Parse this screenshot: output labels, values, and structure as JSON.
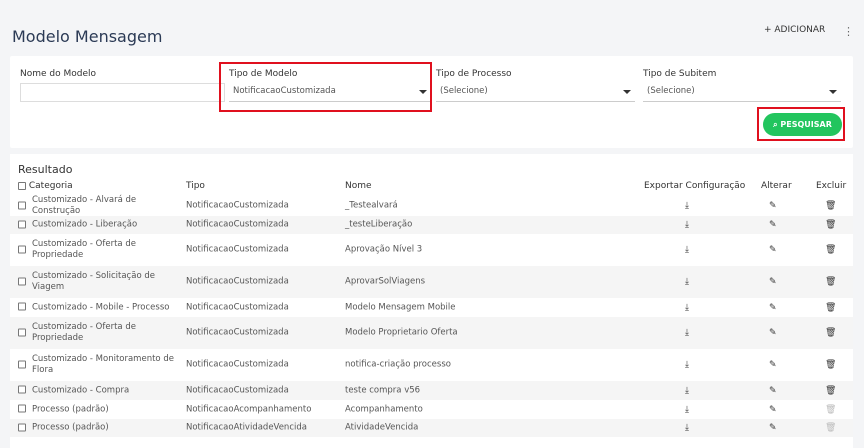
{
  "header": {
    "title": "Modelo Mensagem",
    "add_label": "+ ADICIONAR",
    "menu_label": "⋮"
  },
  "filters": {
    "nome_label": "Nome do Modelo",
    "nome_value": "",
    "tipo_label": "Tipo de Modelo",
    "tipo_value": "NotificacaoCustomizada",
    "processo_label": "Tipo de Processo",
    "processo_value": "(Selecione)",
    "subitem_label": "Tipo de Subitem",
    "subitem_value": "(Selecione)",
    "search_label": "PESQUISAR"
  },
  "results": {
    "title": "Resultado",
    "columns": {
      "categoria": "Categoria",
      "tipo": "Tipo",
      "nome": "Nome",
      "exportar": "Exportar Configuração",
      "alterar": "Alterar",
      "excluir": "Excluir"
    },
    "rows": [
      {
        "categoria": "Customizado - Alvará de Construção",
        "tipo": "NotificacaoCustomizada",
        "nome": "_Testealvará",
        "excluir_enabled": true
      },
      {
        "categoria": "Customizado - Liberação",
        "tipo": "NotificacaoCustomizada",
        "nome": "_testeLiberação",
        "excluir_enabled": true
      },
      {
        "categoria": "Customizado - Oferta de Propriedade",
        "tipo": "NotificacaoCustomizada",
        "nome": "Aprovação Nível 3",
        "excluir_enabled": true
      },
      {
        "categoria": "Customizado - Solicitação de Viagem",
        "tipo": "NotificacaoCustomizada",
        "nome": "AprovarSolViagens",
        "excluir_enabled": true
      },
      {
        "categoria": "Customizado - Mobile - Processo",
        "tipo": "NotificacaoCustomizada",
        "nome": "Modelo Mensagem Mobile",
        "excluir_enabled": true
      },
      {
        "categoria": "Customizado - Oferta de Propriedade",
        "tipo": "NotificacaoCustomizada",
        "nome": "Modelo Proprietario Oferta",
        "excluir_enabled": true
      },
      {
        "categoria": "Customizado - Monitoramento de Flora",
        "tipo": "NotificacaoCustomizada",
        "nome": "notifica-criação processo",
        "excluir_enabled": true
      },
      {
        "categoria": "Customizado - Compra",
        "tipo": "NotificacaoCustomizada",
        "nome": "teste compra v56",
        "excluir_enabled": true
      },
      {
        "categoria": "Processo (padrão)",
        "tipo": "NotificacaoAcompanhamento",
        "nome": "Acompanhamento",
        "excluir_enabled": false
      },
      {
        "categoria": "Processo (padrão)",
        "tipo": "NotificacaoAtividadeVencida",
        "nome": "AtividadeVencida",
        "excluir_enabled": false
      }
    ]
  },
  "colors": {
    "highlight": "#e0101e",
    "search_button": "#22c55e",
    "title": "#2b3a55"
  }
}
